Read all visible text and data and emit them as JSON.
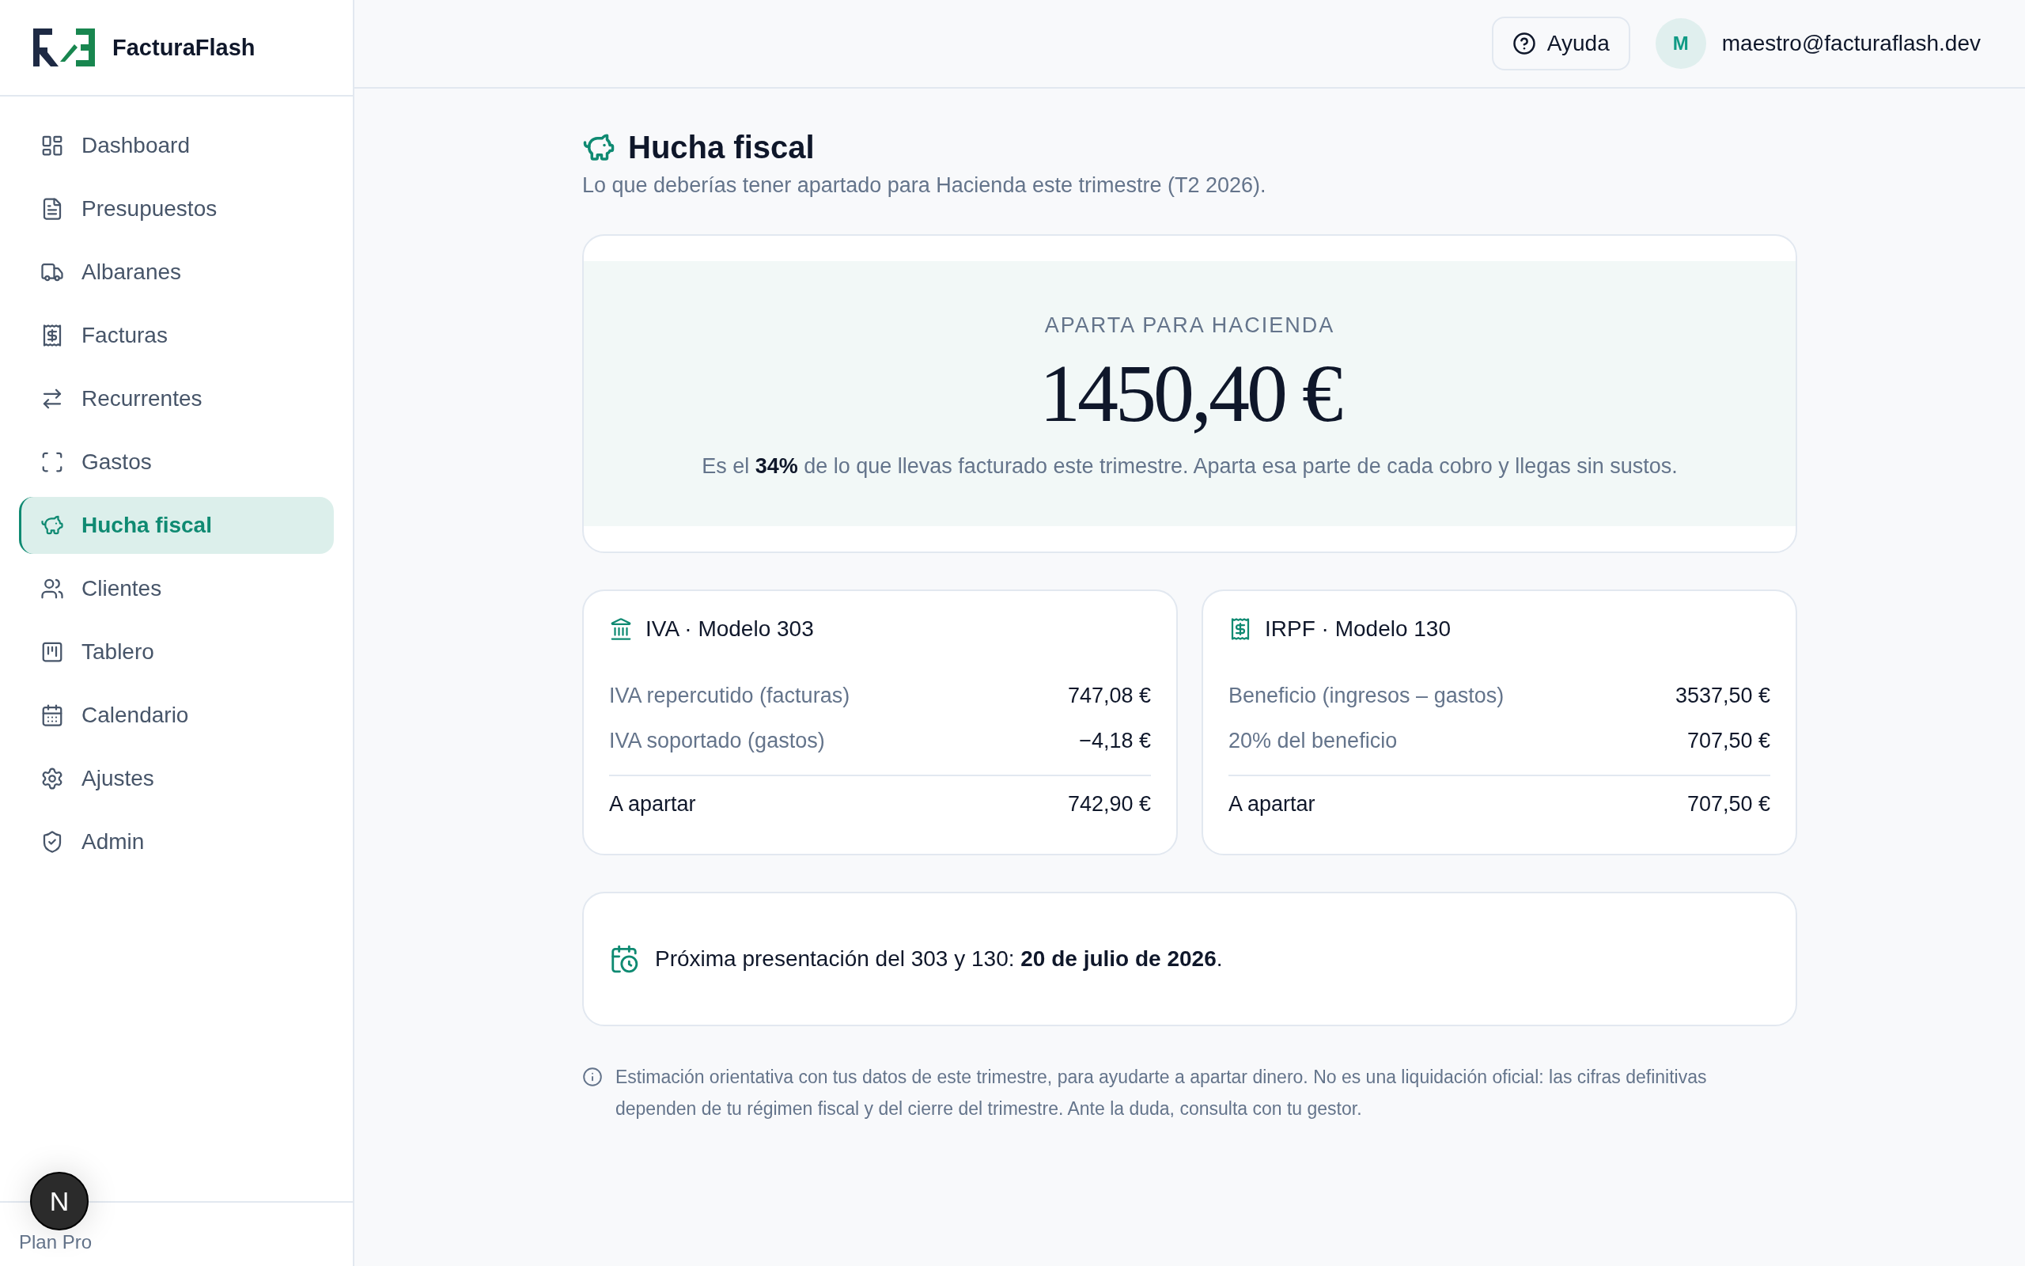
{
  "brand": {
    "name": "FacturaFlash"
  },
  "sidebar": {
    "items": [
      {
        "label": "Dashboard",
        "selected": false
      },
      {
        "label": "Presupuestos",
        "selected": false
      },
      {
        "label": "Albaranes",
        "selected": false
      },
      {
        "label": "Facturas",
        "selected": false
      },
      {
        "label": "Recurrentes",
        "selected": false
      },
      {
        "label": "Gastos",
        "selected": false
      },
      {
        "label": "Hucha fiscal",
        "selected": true
      },
      {
        "label": "Clientes",
        "selected": false
      },
      {
        "label": "Tablero",
        "selected": false
      },
      {
        "label": "Calendario",
        "selected": false
      },
      {
        "label": "Ajustes",
        "selected": false
      },
      {
        "label": "Admin",
        "selected": false
      }
    ],
    "plan": "Plan Pro"
  },
  "dev_badge": "N",
  "header": {
    "help": "Ayuda",
    "avatar": "M",
    "email": "maestro@facturaflash.dev"
  },
  "page": {
    "title": "Hucha fiscal",
    "subtitle": "Lo que deberías tener apartado para Hacienda este trimestre (T2 2026)."
  },
  "hero": {
    "label": "APARTA PARA HACIENDA",
    "amount": "1450,40 €",
    "note": "Es el **34%** de lo que llevas facturado este trimestre. Aparta esa parte de cada cobro y llegas sin sustos."
  },
  "cards": [
    {
      "title": "IVA · Modelo 303",
      "rows": [
        {
          "label": "IVA repercutido (facturas)",
          "value": "747,08 €"
        },
        {
          "label": "IVA soportado (gastos)",
          "value": "−4,18 €"
        }
      ],
      "total": {
        "label": "A apartar",
        "value": "742,90 €"
      }
    },
    {
      "title": "IRPF · Modelo 130",
      "rows": [
        {
          "label": "Beneficio (ingresos – gastos)",
          "value": "3537,50 €"
        },
        {
          "label": "20% del beneficio",
          "value": "707,50 €"
        }
      ],
      "total": {
        "label": "A apartar",
        "value": "707,50 €"
      }
    }
  ],
  "deadline": {
    "text": "Próxima presentación del 303 y 130: **20 de julio de 2026**."
  },
  "disclaimer": "Estimación orientativa con tus datos de este trimestre, para ayudarte a apartar dinero. No es una liquidación oficial: las cifras definitivas dependen de tu régimen fiscal y del cierre del trimestre. Ante la duda, consulta con tu gestor."
}
